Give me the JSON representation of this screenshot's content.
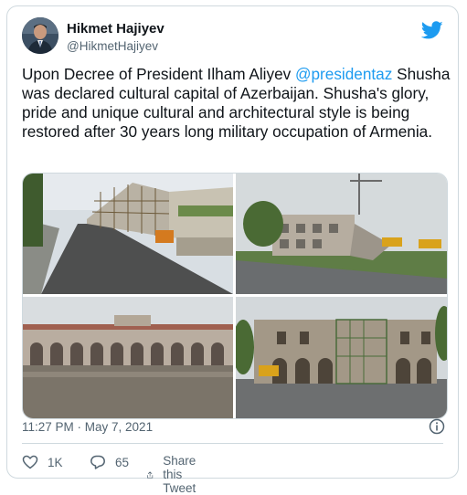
{
  "author": {
    "name": "Hikmet Hajiyev",
    "handle": "@HikmetHajiyev"
  },
  "tweet": {
    "text_prefix": "Upon Decree of President Ilham Aliyev ",
    "mention": "@presidentaz",
    "text_suffix": " Shusha was declared cultural capital of Azerbaijan. Shusha's glory, pride and unique cultural and architectural style is being restored after 30 years long military occupation of Armenia.",
    "timestamp": "11:27 PM · May 7, 2021"
  },
  "actions": {
    "likes": "1K",
    "replies": "65",
    "share_label": "Share this Tweet"
  },
  "icons": {
    "brand": "twitter-bird-icon",
    "info": "info-icon",
    "like": "heart-icon",
    "reply": "reply-bubble-icon",
    "share": "share-icon"
  },
  "colors": {
    "accent": "#1d9bf0",
    "text": "#0f1419",
    "secondary": "#536471",
    "border": "#cfd9de"
  }
}
